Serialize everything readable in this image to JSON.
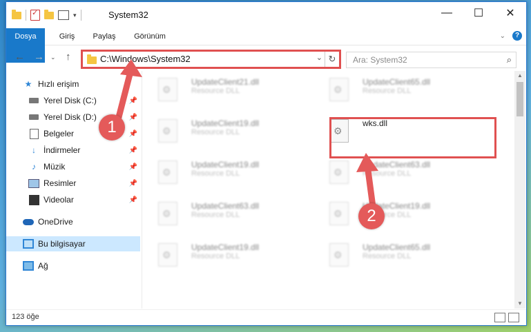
{
  "window": {
    "title": "System32"
  },
  "ribbon": {
    "tabs": [
      "Dosya",
      "Giriş",
      "Paylaş",
      "Görünüm"
    ],
    "help": "?"
  },
  "address": {
    "path": "C:\\Windows\\System32"
  },
  "search": {
    "placeholder": "Ara: System32"
  },
  "nav": {
    "quick_access": "Hızlı erişim",
    "items": [
      "Yerel Disk (C:)",
      "Yerel Disk (D:)",
      "Belgeler",
      "İndirmeler",
      "Müzik",
      "Resimler",
      "Videolar"
    ],
    "onedrive": "OneDrive",
    "this_pc": "Bu bilgisayar",
    "network": "Ağ"
  },
  "files": [
    {
      "name": "UpdateClient21.dll",
      "desc": "Resource DLL"
    },
    {
      "name": "UpdateClient65.dll",
      "desc": "Resource DLL"
    },
    {
      "name": "UpdateClient19.dll",
      "desc": "Resource DLL"
    },
    {
      "name": "wks.dll",
      "desc": ""
    },
    {
      "name": "UpdateClient19.dll",
      "desc": "Resource DLL"
    },
    {
      "name": "UpdateClient63.dll",
      "desc": "Resource DLL"
    },
    {
      "name": "UpdateClient63.dll",
      "desc": "Resource DLL"
    },
    {
      "name": "UpdateClient19.dll",
      "desc": "Resource DLL"
    },
    {
      "name": "UpdateClient19.dll",
      "desc": "Resource DLL"
    },
    {
      "name": "UpdateClient65.dll",
      "desc": "Resource DLL"
    }
  ],
  "status": {
    "count": "123 öğe"
  },
  "annotations": {
    "step1": "1",
    "step2": "2"
  },
  "colors": {
    "accent": "#1979ca",
    "highlight": "#e05050"
  }
}
